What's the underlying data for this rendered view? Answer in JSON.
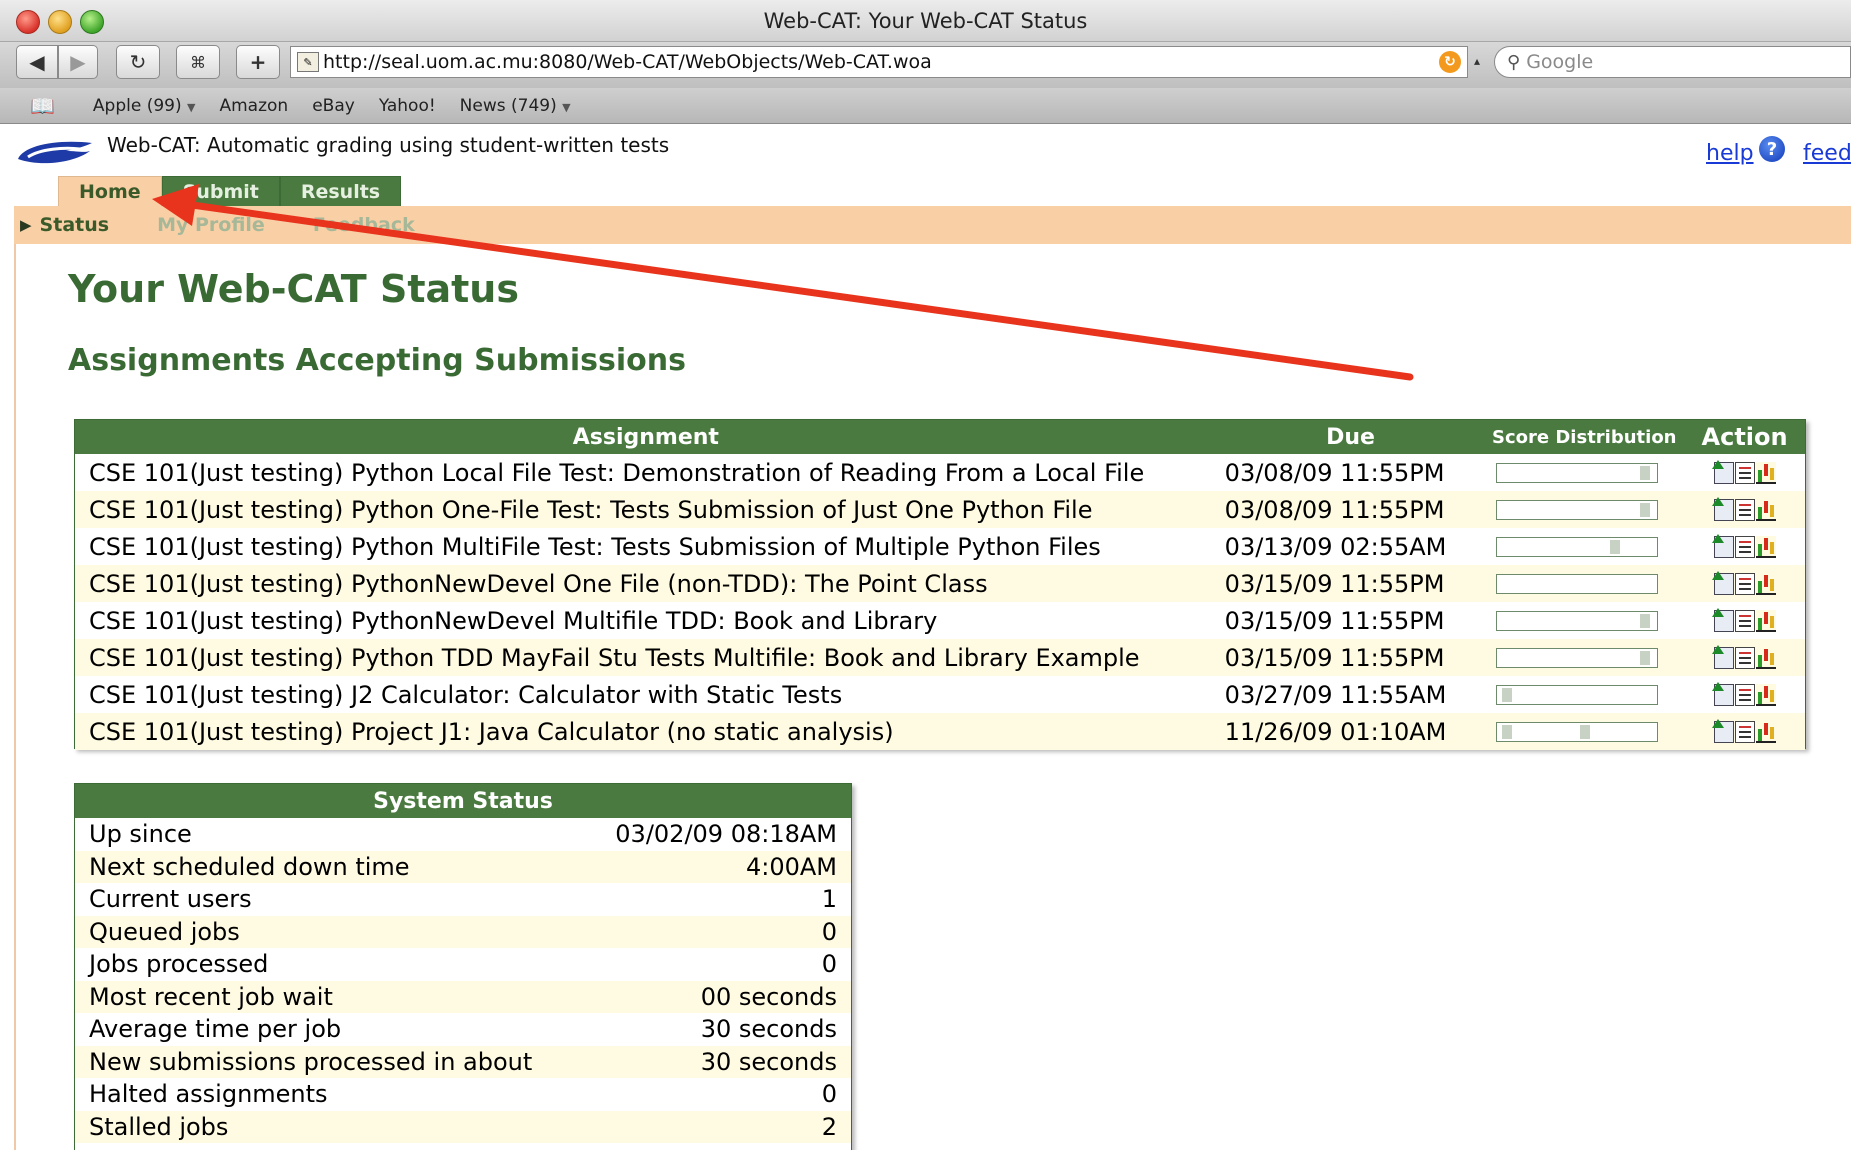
{
  "window": {
    "title": "Web-CAT: Your Web-CAT Status"
  },
  "toolbar": {
    "url": "http://seal.uom.ac.mu:8080/Web-CAT/WebObjects/Web-CAT.woa",
    "search_placeholder": "Google"
  },
  "bookmarks": [
    {
      "label": "Apple (99)",
      "dropdown": true
    },
    {
      "label": "Amazon",
      "dropdown": false
    },
    {
      "label": "eBay",
      "dropdown": false
    },
    {
      "label": "Yahoo!",
      "dropdown": false
    },
    {
      "label": "News (749)",
      "dropdown": true
    }
  ],
  "header": {
    "tagline": "Web-CAT: Automatic grading using student-written tests",
    "help": "help",
    "feed": "feed"
  },
  "tabs": [
    {
      "label": "Home",
      "active": true
    },
    {
      "label": "Submit",
      "active": false
    },
    {
      "label": "Results",
      "active": false
    }
  ],
  "subnav": [
    {
      "label": "Status",
      "current": true
    },
    {
      "label": "My Profile",
      "current": false
    },
    {
      "label": "Feedback",
      "current": false
    }
  ],
  "page": {
    "title": "Your Web-CAT Status",
    "section_title": "Assignments Accepting Submissions"
  },
  "assignments": {
    "columns": [
      "Assignment",
      "Due",
      "Score Distribution",
      "Action"
    ],
    "rows": [
      {
        "name": "CSE 101(Just testing) Python Local File Test: Demonstration of Reading From a Local File",
        "due": "03/08/09 11:55PM",
        "score_marker": 0.95
      },
      {
        "name": "CSE 101(Just testing) Python One-File Test: Tests Submission of Just One Python File",
        "due": "03/08/09 11:55PM",
        "score_marker": 0.95
      },
      {
        "name": "CSE 101(Just testing) Python MultiFile Test: Tests Submission of Multiple Python Files",
        "due": "03/13/09 02:55AM",
        "score_marker": 0.75
      },
      {
        "name": "CSE 101(Just testing) PythonNewDevel One File (non-TDD): The Point Class",
        "due": "03/15/09 11:55PM",
        "score_marker": null
      },
      {
        "name": "CSE 101(Just testing) PythonNewDevel Multifile TDD: Book and Library",
        "due": "03/15/09 11:55PM",
        "score_marker": 0.95
      },
      {
        "name": "CSE 101(Just testing) Python TDD MayFail Stu Tests Multifile: Book and Library Example",
        "due": "03/15/09 11:55PM",
        "score_marker": 0.95
      },
      {
        "name": "CSE 101(Just testing) J2 Calculator: Calculator with Static Tests",
        "due": "03/27/09 11:55AM",
        "score_marker": 0.03
      },
      {
        "name": "CSE 101(Just testing) Project J1: Java Calculator (no static analysis)",
        "due": "11/26/09 01:10AM",
        "score_marker": 0.03,
        "score_marker_2": 0.55
      }
    ]
  },
  "system_status": {
    "title": "System Status",
    "rows": [
      {
        "label": "Up since",
        "value": "03/02/09 08:18AM"
      },
      {
        "label": "Next scheduled down time",
        "value": "4:00AM"
      },
      {
        "label": "Current users",
        "value": "1"
      },
      {
        "label": "Queued jobs",
        "value": "0"
      },
      {
        "label": "Jobs processed",
        "value": "0"
      },
      {
        "label": "Most recent job wait",
        "value": "00 seconds"
      },
      {
        "label": "Average time per job",
        "value": "30 seconds"
      },
      {
        "label": "New submissions processed in about",
        "value": "30 seconds"
      },
      {
        "label": "Halted assignments",
        "value": "0"
      },
      {
        "label": "Stalled jobs",
        "value": "2"
      }
    ]
  },
  "colors": {
    "brand_green": "#4a7a3f",
    "heading_green": "#3a6a34",
    "nav_peach": "#f9cfa6",
    "row_alt": "#fffbe2",
    "annotation_arrow": "#e8341c",
    "link_blue": "#1a3ad6"
  },
  "icons": {
    "action": [
      "upload-submission-icon",
      "report-icon",
      "score-chart-icon"
    ],
    "logo": "web-cat-logo",
    "help": "help-question-icon"
  }
}
